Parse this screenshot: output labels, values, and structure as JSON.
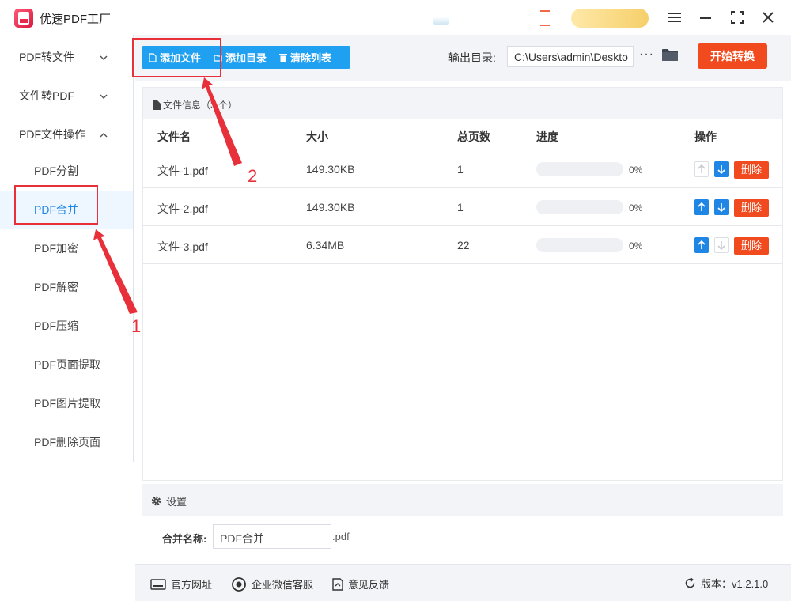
{
  "app": {
    "title": "优速PDF工厂"
  },
  "sidebar": {
    "groups": [
      {
        "label": "PDF转文件",
        "caret": "down"
      },
      {
        "label": "文件转PDF",
        "caret": "down"
      },
      {
        "label": "PDF文件操作",
        "caret": "up"
      }
    ],
    "items": [
      {
        "label": "PDF分割"
      },
      {
        "label": "PDF合并",
        "active": true
      },
      {
        "label": "PDF加密"
      },
      {
        "label": "PDF解密"
      },
      {
        "label": "PDF压缩"
      },
      {
        "label": "PDF页面提取"
      },
      {
        "label": "PDF图片提取"
      },
      {
        "label": "PDF删除页面"
      }
    ]
  },
  "toolbar": {
    "add_file": "添加文件",
    "add_folder": "添加目录",
    "clear_list": "清除列表",
    "output_label": "输出目录:",
    "output_path": "C:\\Users\\admin\\Deskto",
    "more": "···",
    "start": "开始转换"
  },
  "file_info": {
    "title": "文件信息（3 个）"
  },
  "table": {
    "headers": {
      "name": "文件名",
      "size": "大小",
      "pages": "总页数",
      "progress": "进度",
      "actions": "操作"
    },
    "delete_label": "删除",
    "rows": [
      {
        "name": "文件-1.pdf",
        "size": "149.30KB",
        "pages": "1",
        "progress": 0,
        "progress_text": "0%",
        "up_enabled": false,
        "down_enabled": true
      },
      {
        "name": "文件-2.pdf",
        "size": "149.30KB",
        "pages": "1",
        "progress": 0,
        "progress_text": "0%",
        "up_enabled": true,
        "down_enabled": true
      },
      {
        "name": "文件-3.pdf",
        "size": "6.34MB",
        "pages": "22",
        "progress": 0,
        "progress_text": "0%",
        "up_enabled": true,
        "down_enabled": false
      }
    ]
  },
  "settings": {
    "title": "设置",
    "merge_label": "合并名称:",
    "merge_value": "PDF合并",
    "merge_ext": ".pdf"
  },
  "footer": {
    "website": "官方网址",
    "wechat": "企业微信客服",
    "feedback": "意见反馈",
    "version": "版本：v1.2.1.0"
  },
  "annotations": {
    "step1": "1",
    "step2": "2",
    "color": "#e8303a"
  },
  "colors": {
    "primary": "#20a0f0",
    "accent": "#f24a1f",
    "active_blue": "#1e86e6"
  }
}
